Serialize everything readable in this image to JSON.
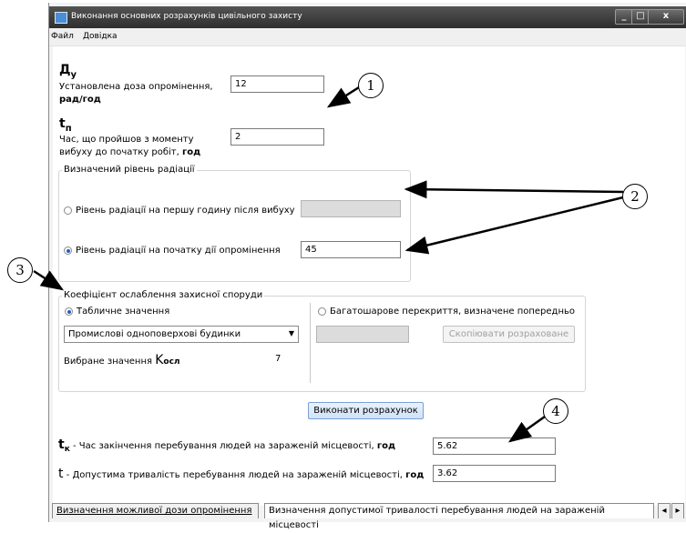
{
  "window": {
    "title": "Виконання основних розрахунків цивільного захисту",
    "controls": {
      "minimize": "_",
      "maximize": "□",
      "close": "x"
    }
  },
  "menu": {
    "items": [
      "Файл",
      "Довідка"
    ]
  },
  "dose": {
    "symbol": "Д",
    "subscript": "у",
    "label_line1": "Установлена доза опромінення,",
    "label_unit": "рад/год",
    "value": "12"
  },
  "time_start": {
    "symbol": "t",
    "subscript": "п",
    "label_line1": "Час, що пройшов з моменту",
    "label_line2": "вибуху до початку робіт,",
    "label_unit": "год",
    "value": "2"
  },
  "radiation_group": {
    "title": "Визначений рівень радіації",
    "option1": {
      "label": "Рівень радіації на першу годину після вибуху",
      "value": ""
    },
    "option2": {
      "label": "Рівень радіації на початку дії опромінення",
      "value": "45",
      "selected": true
    }
  },
  "attenuation_group": {
    "title": "Коефіцієнт ослаблення захисної споруди",
    "table_option": "Табличне значення",
    "combo_value": "Промислові одноповерхові будинки",
    "selected_label": "Вибране значення",
    "k_symbol": "K",
    "k_subscript": "осл",
    "selected_value": "7",
    "multilayer_option": "Багатошарове перекриття, визначене попередньо",
    "copy_button": "Скопіювати розраховане"
  },
  "run_button": "Виконати розрахунок",
  "result_end": {
    "symbol": "t",
    "subscript": "к",
    "dash": " - ",
    "label": "Час закінчення перебування людей на зараженій місцевості,",
    "unit": "год",
    "value": "5.62"
  },
  "result_duration": {
    "symbol": "t",
    "dash": " - ",
    "label": "Допустима тривалість перебування людей на зараженій місцевості,",
    "unit": "год",
    "value": "3.62"
  },
  "tabs": [
    "Визначення можливої дози опромінення",
    "Визначення допустимої тривалості перебування людей на зараженій місцевості"
  ],
  "tab_scroll": {
    "left": "◂",
    "right": "▸"
  },
  "callouts": [
    "1",
    "2",
    "3",
    "4"
  ],
  "colors": {
    "titlebar": "#3c3c3c",
    "selection": "#2060c0",
    "button": "#cfe2f8"
  }
}
